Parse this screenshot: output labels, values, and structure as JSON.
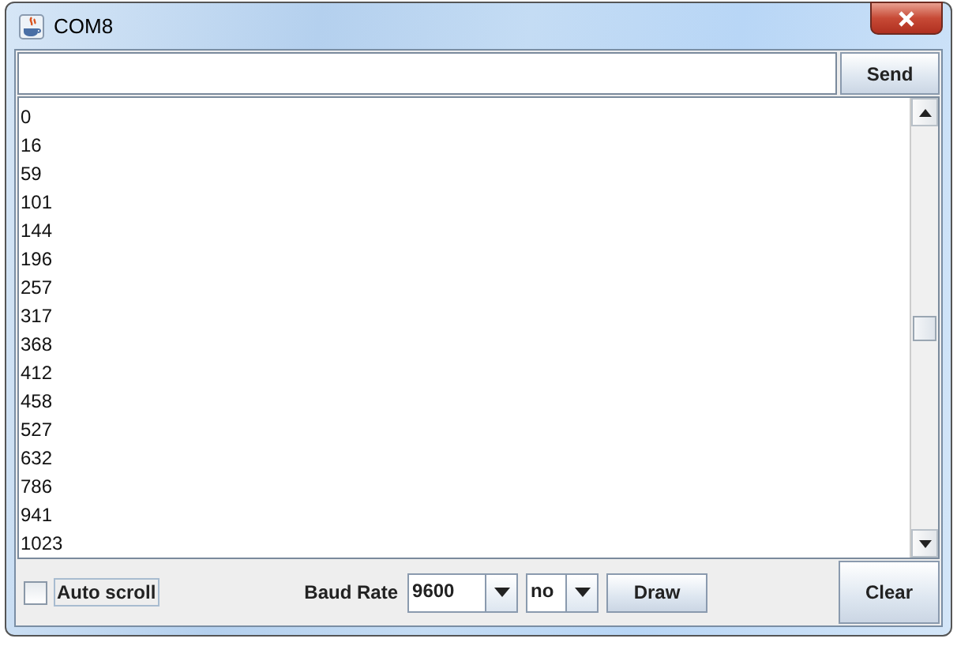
{
  "window": {
    "title": "COM8"
  },
  "send_button": {
    "label": "Send"
  },
  "output_lines": [
    "0",
    "16",
    "59",
    "101",
    "144",
    "196",
    "257",
    "317",
    "368",
    "412",
    "458",
    "527",
    "632",
    "786",
    "941",
    "1023"
  ],
  "auto_scroll": {
    "label": "Auto scroll",
    "checked": false
  },
  "baud_rate": {
    "label": "Baud Rate",
    "value": "9600"
  },
  "line_ending": {
    "value": "no"
  },
  "draw_button": {
    "label": "Draw"
  },
  "clear_button": {
    "label": "Clear"
  }
}
